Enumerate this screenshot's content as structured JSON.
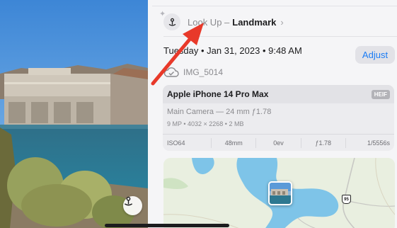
{
  "lookup": {
    "prefix": "Look Up –",
    "subject": "Landmark",
    "chevron": "›",
    "icon": "landmark-icon"
  },
  "photo_info": {
    "date": "Tuesday • Jan 31, 2023 • 9:48 AM",
    "adjust_label": "Adjust",
    "file_name": "IMG_5014",
    "cloud_icon": "cloud-check-icon"
  },
  "camera_card": {
    "device": "Apple iPhone 14 Pro Max",
    "format_badge": "HEIF",
    "lens": "Main Camera — 24 mm ƒ1.78",
    "specs": "9 MP • 4032 × 2268 • 2 MB",
    "exif": [
      "ISO64",
      "48mm",
      "0ev",
      "ƒ1.78",
      "1/5556s"
    ]
  },
  "map": {
    "highway_shield": "95"
  },
  "colors": {
    "accent": "#1a7cf5",
    "annotation_arrow": "#e8392a"
  }
}
